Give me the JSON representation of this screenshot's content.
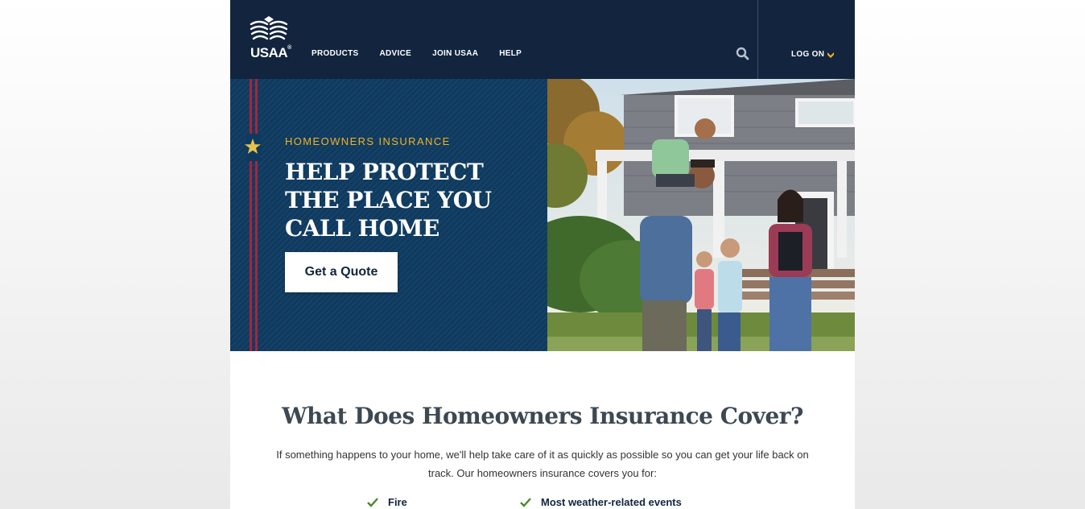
{
  "brand": {
    "name": "USAA",
    "registered": "®"
  },
  "nav": {
    "items": [
      {
        "label": "PRODUCTS"
      },
      {
        "label": "ADVICE"
      },
      {
        "label": "JOIN USAA"
      },
      {
        "label": "HELP"
      }
    ],
    "search_icon": "search-icon",
    "logon_label": "LOG ON",
    "logon_icon": "chevron-down-icon"
  },
  "hero": {
    "eyebrow": "HOMEOWNERS INSURANCE",
    "headline": "HELP PROTECT THE PLACE YOU CALL HOME",
    "cta_label": "Get a Quote",
    "star_icon": "star-icon"
  },
  "coverage": {
    "title": "What Does Homeowners Insurance Cover?",
    "body": "If something happens to your home, we'll help take care of it as quickly as possible so you can get your life back on track. Our homeowners insurance covers you for:",
    "items": [
      {
        "label": "Fire"
      },
      {
        "label": "Most weather-related events"
      }
    ],
    "check_icon": "checkmark-icon"
  },
  "colors": {
    "header_bg": "#12243e",
    "hero_bg": "#0f3a5f",
    "accent_gold": "#f0b323",
    "accent_red": "#a8243a",
    "check_green": "#4a8a2a"
  }
}
